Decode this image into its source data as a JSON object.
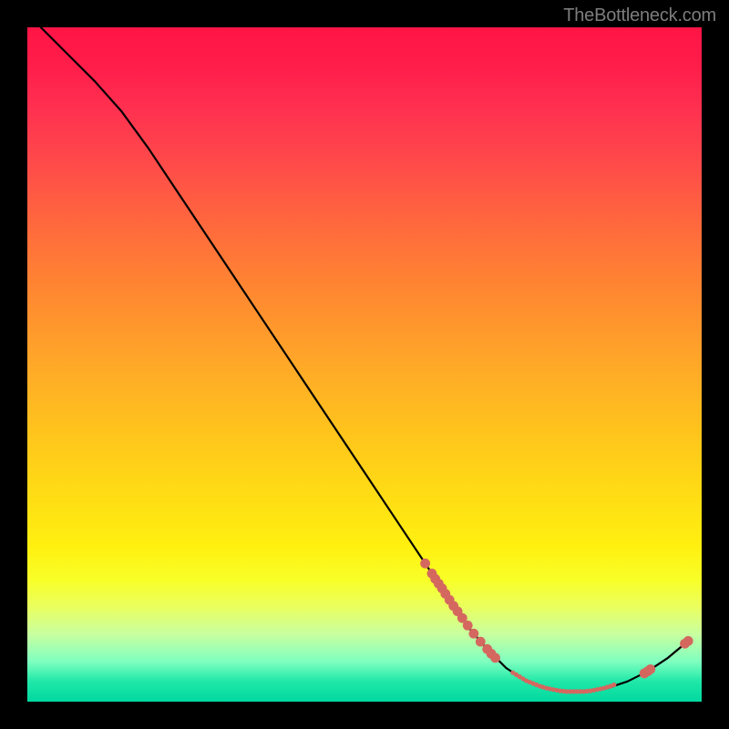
{
  "attribution": "TheBottleneck.com",
  "chart_data": {
    "type": "line",
    "title": "",
    "xlabel": "",
    "ylabel": "",
    "xlim": [
      0,
      100
    ],
    "ylim": [
      0,
      100
    ],
    "curve": {
      "name": "bottleneck-curve",
      "color": "#000000",
      "points": [
        {
          "x": 2,
          "y": 100
        },
        {
          "x": 6,
          "y": 96
        },
        {
          "x": 10,
          "y": 92
        },
        {
          "x": 14,
          "y": 87.5
        },
        {
          "x": 18,
          "y": 82
        },
        {
          "x": 22,
          "y": 76
        },
        {
          "x": 26,
          "y": 70
        },
        {
          "x": 30,
          "y": 64
        },
        {
          "x": 34,
          "y": 58
        },
        {
          "x": 38,
          "y": 52
        },
        {
          "x": 42,
          "y": 46
        },
        {
          "x": 46,
          "y": 40
        },
        {
          "x": 50,
          "y": 34
        },
        {
          "x": 54,
          "y": 28
        },
        {
          "x": 58,
          "y": 22
        },
        {
          "x": 62,
          "y": 16
        },
        {
          "x": 65,
          "y": 11.5
        },
        {
          "x": 68,
          "y": 8
        },
        {
          "x": 71,
          "y": 5
        },
        {
          "x": 74,
          "y": 3
        },
        {
          "x": 77,
          "y": 2
        },
        {
          "x": 80,
          "y": 1.5
        },
        {
          "x": 83,
          "y": 1.5
        },
        {
          "x": 86,
          "y": 2
        },
        {
          "x": 89,
          "y": 3
        },
        {
          "x": 92,
          "y": 4.5
        },
        {
          "x": 95,
          "y": 6.5
        },
        {
          "x": 98,
          "y": 9
        }
      ]
    },
    "series": [
      {
        "name": "markers-descent",
        "color": "#d4685f",
        "marker": "circle",
        "points": [
          {
            "x": 59,
            "y": 20.5
          },
          {
            "x": 60,
            "y": 19
          },
          {
            "x": 60.5,
            "y": 18.2
          },
          {
            "x": 61,
            "y": 17.5
          },
          {
            "x": 61.5,
            "y": 16.8
          },
          {
            "x": 62,
            "y": 16
          },
          {
            "x": 62.6,
            "y": 15.1
          },
          {
            "x": 63.2,
            "y": 14.2
          },
          {
            "x": 63.8,
            "y": 13.4
          },
          {
            "x": 64.5,
            "y": 12.4
          },
          {
            "x": 65.3,
            "y": 11.3
          },
          {
            "x": 66.2,
            "y": 10.1
          },
          {
            "x": 67.2,
            "y": 8.9
          },
          {
            "x": 68.2,
            "y": 7.8
          },
          {
            "x": 68.8,
            "y": 7.1
          },
          {
            "x": 69.4,
            "y": 6.5
          }
        ]
      },
      {
        "name": "markers-ascent",
        "color": "#d4685f",
        "marker": "circle",
        "points": [
          {
            "x": 91.5,
            "y": 4.2
          },
          {
            "x": 92.0,
            "y": 4.5
          },
          {
            "x": 92.4,
            "y": 4.8
          },
          {
            "x": 97.5,
            "y": 8.6
          },
          {
            "x": 98.0,
            "y": 9.0
          }
        ]
      },
      {
        "name": "markers-floor",
        "color": "#d4685f",
        "marker": "dot-small",
        "points": [
          {
            "x": 72.0,
            "y": 4.3
          },
          {
            "x": 72.5,
            "y": 4.0
          },
          {
            "x": 73.0,
            "y": 3.7
          },
          {
            "x": 73.5,
            "y": 3.4
          },
          {
            "x": 74.0,
            "y": 3.1
          },
          {
            "x": 74.5,
            "y": 2.9
          },
          {
            "x": 75.0,
            "y": 2.7
          },
          {
            "x": 75.5,
            "y": 2.5
          },
          {
            "x": 76.0,
            "y": 2.3
          },
          {
            "x": 76.5,
            "y": 2.15
          },
          {
            "x": 77.0,
            "y": 2.0
          },
          {
            "x": 77.5,
            "y": 1.9
          },
          {
            "x": 78.0,
            "y": 1.8
          },
          {
            "x": 78.5,
            "y": 1.7
          },
          {
            "x": 79.0,
            "y": 1.6
          },
          {
            "x": 79.5,
            "y": 1.55
          },
          {
            "x": 80.0,
            "y": 1.5
          },
          {
            "x": 80.5,
            "y": 1.5
          },
          {
            "x": 81.0,
            "y": 1.5
          },
          {
            "x": 81.5,
            "y": 1.5
          },
          {
            "x": 82.0,
            "y": 1.5
          },
          {
            "x": 82.5,
            "y": 1.5
          },
          {
            "x": 83.0,
            "y": 1.55
          },
          {
            "x": 83.5,
            "y": 1.6
          },
          {
            "x": 84.0,
            "y": 1.7
          },
          {
            "x": 84.5,
            "y": 1.8
          },
          {
            "x": 85.0,
            "y": 1.9
          },
          {
            "x": 85.5,
            "y": 2.0
          },
          {
            "x": 86.0,
            "y": 2.15
          },
          {
            "x": 86.5,
            "y": 2.3
          },
          {
            "x": 87.0,
            "y": 2.5
          }
        ]
      }
    ]
  }
}
